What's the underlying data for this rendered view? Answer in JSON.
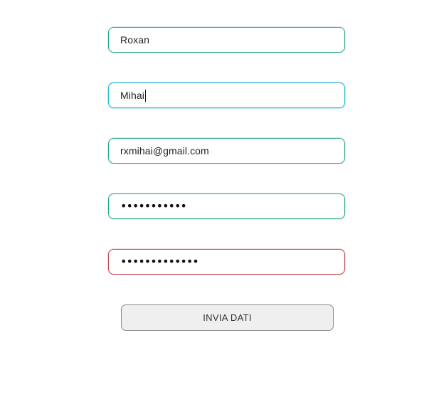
{
  "form": {
    "fields": [
      {
        "value": "Roxan",
        "state": "valid"
      },
      {
        "value": "Mihai",
        "state": "focused"
      },
      {
        "value": "rxmihai@gmail.com",
        "state": "valid"
      },
      {
        "value": "•••••••••••",
        "state": "valid"
      },
      {
        "value": "•••••••••••••",
        "state": "error"
      }
    ],
    "submit_label": "INVIA DATI"
  },
  "colors": {
    "valid_border": "#2aa98a",
    "focus_border": "#31b8d6",
    "error_border": "#c0484f",
    "button_bg": "#efefef"
  }
}
